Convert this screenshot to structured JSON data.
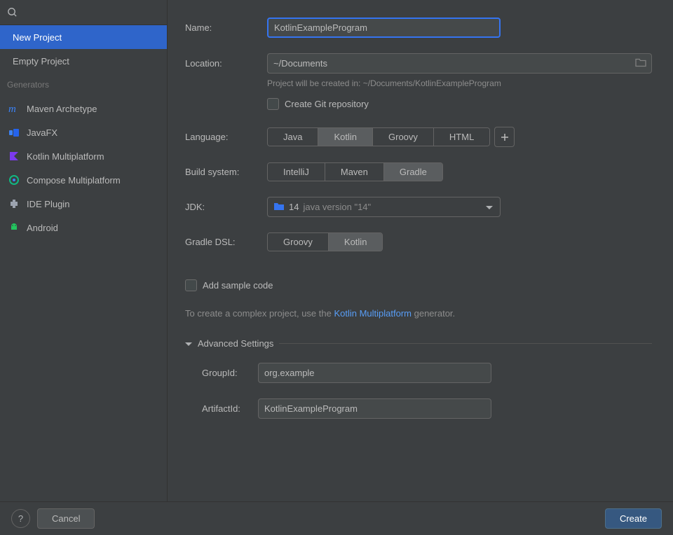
{
  "sidebar": {
    "items": [
      {
        "label": "New Project"
      },
      {
        "label": "Empty Project"
      }
    ],
    "generatorsHeader": "Generators",
    "generators": [
      {
        "label": "Maven Archetype",
        "iconColor": "#3b82f6"
      },
      {
        "label": "JavaFX",
        "iconColor": "#3b82f6"
      },
      {
        "label": "Kotlin Multiplatform",
        "iconColor": "#8b5cf6"
      },
      {
        "label": "Compose Multiplatform",
        "iconColor": "#10b981"
      },
      {
        "label": "IDE Plugin",
        "iconColor": "#9ca3af"
      },
      {
        "label": "Android",
        "iconColor": "#22c55e"
      }
    ]
  },
  "form": {
    "nameLabel": "Name:",
    "nameValue": "KotlinExampleProgram",
    "locationLabel": "Location:",
    "locationValue": "~/Documents",
    "locationHint": "Project will be created in: ~/Documents/KotlinExampleProgram",
    "gitLabel": "Create Git repository",
    "languageLabel": "Language:",
    "languages": [
      "Java",
      "Kotlin",
      "Groovy",
      "HTML"
    ],
    "languageSelected": "Kotlin",
    "buildLabel": "Build system:",
    "buildSystems": [
      "IntelliJ",
      "Maven",
      "Gradle"
    ],
    "buildSelected": "Gradle",
    "jdkLabel": "JDK:",
    "jdkValue": "14",
    "jdkDetail": "java version \"14\"",
    "dslLabel": "Gradle DSL:",
    "dsls": [
      "Groovy",
      "Kotlin"
    ],
    "dslSelected": "Kotlin",
    "sampleLabel": "Add sample code",
    "complexPre": "To create a complex project, use the ",
    "complexLink": "Kotlin Multiplatform",
    "complexPost": " generator.",
    "advancedLabel": "Advanced Settings",
    "groupIdLabel": "GroupId:",
    "groupIdValue": "org.example",
    "artifactIdLabel": "ArtifactId:",
    "artifactIdValue": "KotlinExampleProgram"
  },
  "buttons": {
    "cancel": "Cancel",
    "create": "Create"
  }
}
